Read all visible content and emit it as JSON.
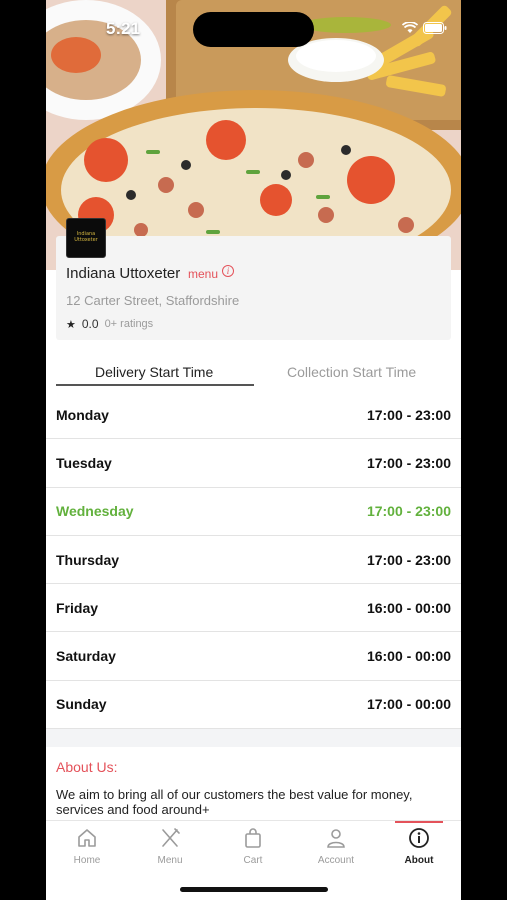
{
  "status_bar": {
    "time": "5:21"
  },
  "restaurant": {
    "logo_text": "Indiana Uttoxeter",
    "name": "Indiana Uttoxeter",
    "menu_label": "menu",
    "address": "12 Carter Street, Staffordshire",
    "rating": "0.0",
    "rating_count": "0+ ratings"
  },
  "tabs": {
    "delivery": "Delivery Start Time",
    "collection": "Collection Start Time"
  },
  "schedule": [
    {
      "day": "Monday",
      "hours": "17:00 - 23:00"
    },
    {
      "day": "Tuesday",
      "hours": "17:00 - 23:00"
    },
    {
      "day": "Wednesday",
      "hours": "17:00 - 23:00",
      "today": true
    },
    {
      "day": "Thursday",
      "hours": "17:00 - 23:00"
    },
    {
      "day": "Friday",
      "hours": "16:00 - 00:00"
    },
    {
      "day": "Saturday",
      "hours": "16:00 - 00:00"
    },
    {
      "day": "Sunday",
      "hours": "17:00 - 00:00"
    }
  ],
  "about": {
    "title": "About Us:",
    "text": "We aim to bring all of our customers the best value for money, services and food around+"
  },
  "tabbar": {
    "home": "Home",
    "menu": "Menu",
    "cart": "Cart",
    "account": "Account",
    "about": "About"
  },
  "colors": {
    "accent": "#e4525a",
    "today": "#62b13d"
  }
}
